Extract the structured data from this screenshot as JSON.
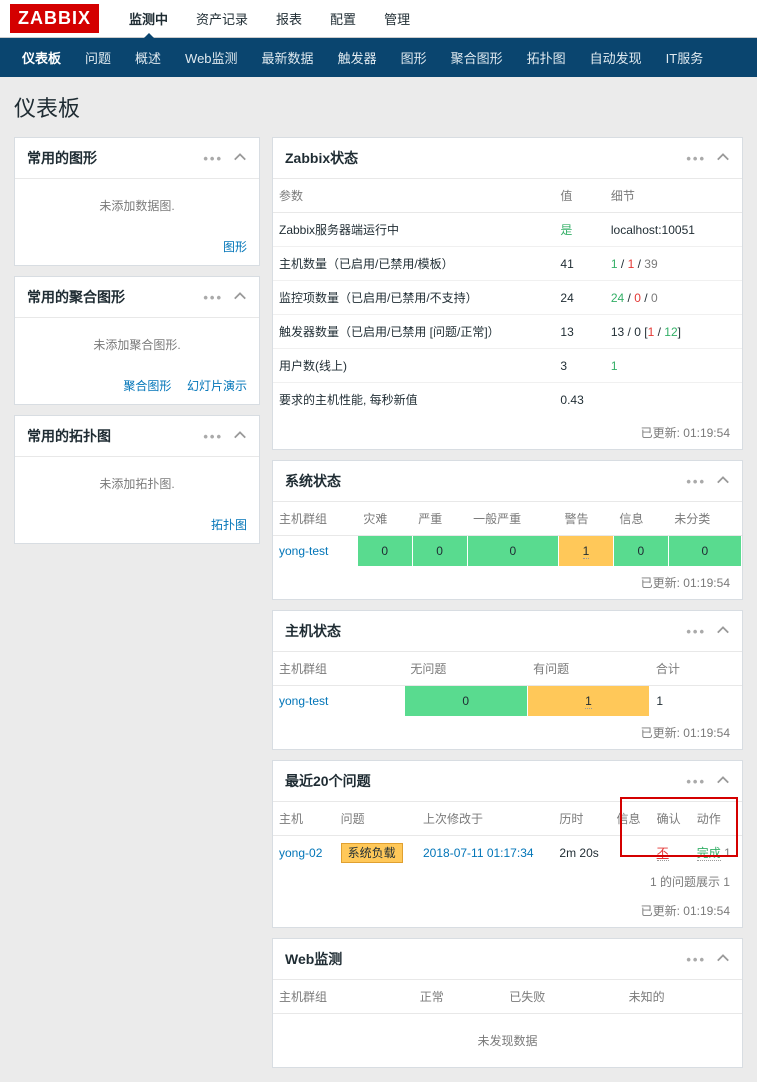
{
  "logo": "ZABBIX",
  "topnav": [
    {
      "label": "监测中",
      "active": true
    },
    {
      "label": "资产记录"
    },
    {
      "label": "报表"
    },
    {
      "label": "配置"
    },
    {
      "label": "管理"
    }
  ],
  "subnav": [
    {
      "label": "仪表板",
      "active": true
    },
    {
      "label": "问题"
    },
    {
      "label": "概述"
    },
    {
      "label": "Web监测"
    },
    {
      "label": "最新数据"
    },
    {
      "label": "触发器"
    },
    {
      "label": "图形"
    },
    {
      "label": "聚合图形"
    },
    {
      "label": "拓扑图"
    },
    {
      "label": "自动发现"
    },
    {
      "label": "IT服务"
    }
  ],
  "pageTitle": "仪表板",
  "widgets": {
    "favGraphs": {
      "title": "常用的图形",
      "empty": "未添加数据图.",
      "links": [
        "图形"
      ]
    },
    "favScreens": {
      "title": "常用的聚合图形",
      "empty": "未添加聚合图形.",
      "links": [
        "聚合图形",
        "幻灯片演示"
      ]
    },
    "favMaps": {
      "title": "常用的拓扑图",
      "empty": "未添加拓扑图.",
      "links": [
        "拓扑图"
      ]
    },
    "zabbixStatus": {
      "title": "Zabbix状态",
      "headers": [
        "参数",
        "值",
        "细节"
      ],
      "rows": [
        {
          "param": "Zabbix服务器端运行中",
          "val": "是",
          "valClass": "green",
          "detail": "localhost:10051"
        },
        {
          "param": "主机数量（已启用/已禁用/模板）",
          "val": "41",
          "detailParts": [
            {
              "t": "1",
              "c": "green"
            },
            {
              "t": " / "
            },
            {
              "t": "1",
              "c": "red"
            },
            {
              "t": " / "
            },
            {
              "t": "39",
              "c": "gray"
            }
          ]
        },
        {
          "param": "监控项数量（已启用/已禁用/不支持）",
          "val": "24",
          "detailParts": [
            {
              "t": "24",
              "c": "green"
            },
            {
              "t": " / "
            },
            {
              "t": "0",
              "c": "red"
            },
            {
              "t": " / "
            },
            {
              "t": "0",
              "c": "gray"
            }
          ]
        },
        {
          "param": "触发器数量（已启用/已禁用 [问题/正常]）",
          "val": "13",
          "detailParts": [
            {
              "t": "13"
            },
            {
              "t": " / "
            },
            {
              "t": "0"
            },
            {
              "t": " ["
            },
            {
              "t": "1",
              "c": "red"
            },
            {
              "t": " / "
            },
            {
              "t": "12",
              "c": "green"
            },
            {
              "t": "]"
            }
          ]
        },
        {
          "param": "用户数(线上)",
          "val": "3",
          "detailParts": [
            {
              "t": "1",
              "c": "green"
            }
          ]
        },
        {
          "param": "要求的主机性能, 每秒新值",
          "val": "0.43",
          "detail": ""
        }
      ],
      "updated": "已更新: 01:19:54"
    },
    "systemStatus": {
      "title": "系统状态",
      "headers": [
        "主机群组",
        "灾难",
        "严重",
        "一般严重",
        "警告",
        "信息",
        "未分类"
      ],
      "rows": [
        {
          "group": "yong-test",
          "cells": [
            {
              "v": "0",
              "bg": "bg-green"
            },
            {
              "v": "0",
              "bg": "bg-green"
            },
            {
              "v": "0",
              "bg": "bg-green"
            },
            {
              "v": "1",
              "bg": "bg-orange",
              "u": true
            },
            {
              "v": "0",
              "bg": "bg-green"
            },
            {
              "v": "0",
              "bg": "bg-green"
            }
          ]
        }
      ],
      "updated": "已更新: 01:19:54"
    },
    "hostStatus": {
      "title": "主机状态",
      "headers": [
        "主机群组",
        "无问题",
        "有问题",
        "合计"
      ],
      "rows": [
        {
          "group": "yong-test",
          "cells": [
            {
              "v": "0",
              "bg": "bg-green"
            },
            {
              "v": "1",
              "bg": "bg-orange",
              "u": true
            },
            {
              "v": "1"
            }
          ]
        }
      ],
      "updated": "已更新: 01:19:54"
    },
    "lastIssues": {
      "title": "最近20个问题",
      "headers": [
        "主机",
        "问题",
        "上次修改于",
        "历时",
        "信息",
        "确认",
        "动作"
      ],
      "row": {
        "host": "yong-02",
        "issue": "系统负载",
        "time": "2018-07-11 01:17:34",
        "age": "2m 20s",
        "info": "",
        "ack": "不",
        "action": "完成",
        "actionCount": "1"
      },
      "summary": "1 的问题展示 1",
      "updated": "已更新: 01:19:54"
    },
    "webMon": {
      "title": "Web监测",
      "headers": [
        "主机群组",
        "正常",
        "已失败",
        "未知的"
      ],
      "empty": "未发现数据"
    }
  }
}
